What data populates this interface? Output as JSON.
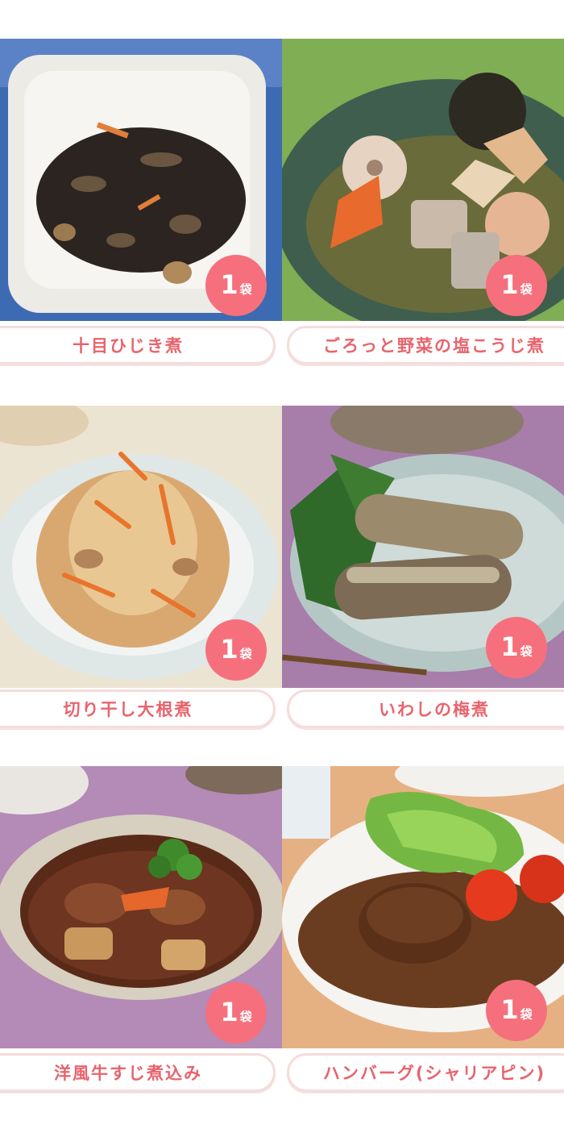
{
  "items": [
    {
      "name": "十目ひじき煮",
      "count": "1",
      "unit": "袋",
      "icon": "hijiki-dish-photo"
    },
    {
      "name": "ごろっと野菜の塩こうじ煮",
      "count": "1",
      "unit": "袋",
      "icon": "vegetable-shiokoji-stew-photo"
    },
    {
      "name": "切り干し大根煮",
      "count": "1",
      "unit": "袋",
      "icon": "kiriboshi-daikon-dish-photo"
    },
    {
      "name": "いわしの梅煮",
      "count": "1",
      "unit": "袋",
      "icon": "sardine-ume-dish-photo"
    },
    {
      "name": "洋風牛すじ煮込み",
      "count": "1",
      "unit": "袋",
      "icon": "beef-tendon-stew-photo"
    },
    {
      "name": "ハンバーグ(シャリアピン)",
      "count": "1",
      "unit": "袋",
      "icon": "hamburg-steak-photo"
    }
  ],
  "colors": {
    "badge": "#f5707c",
    "label_text": "#e8646d",
    "label_border": "#f6dcdc"
  }
}
